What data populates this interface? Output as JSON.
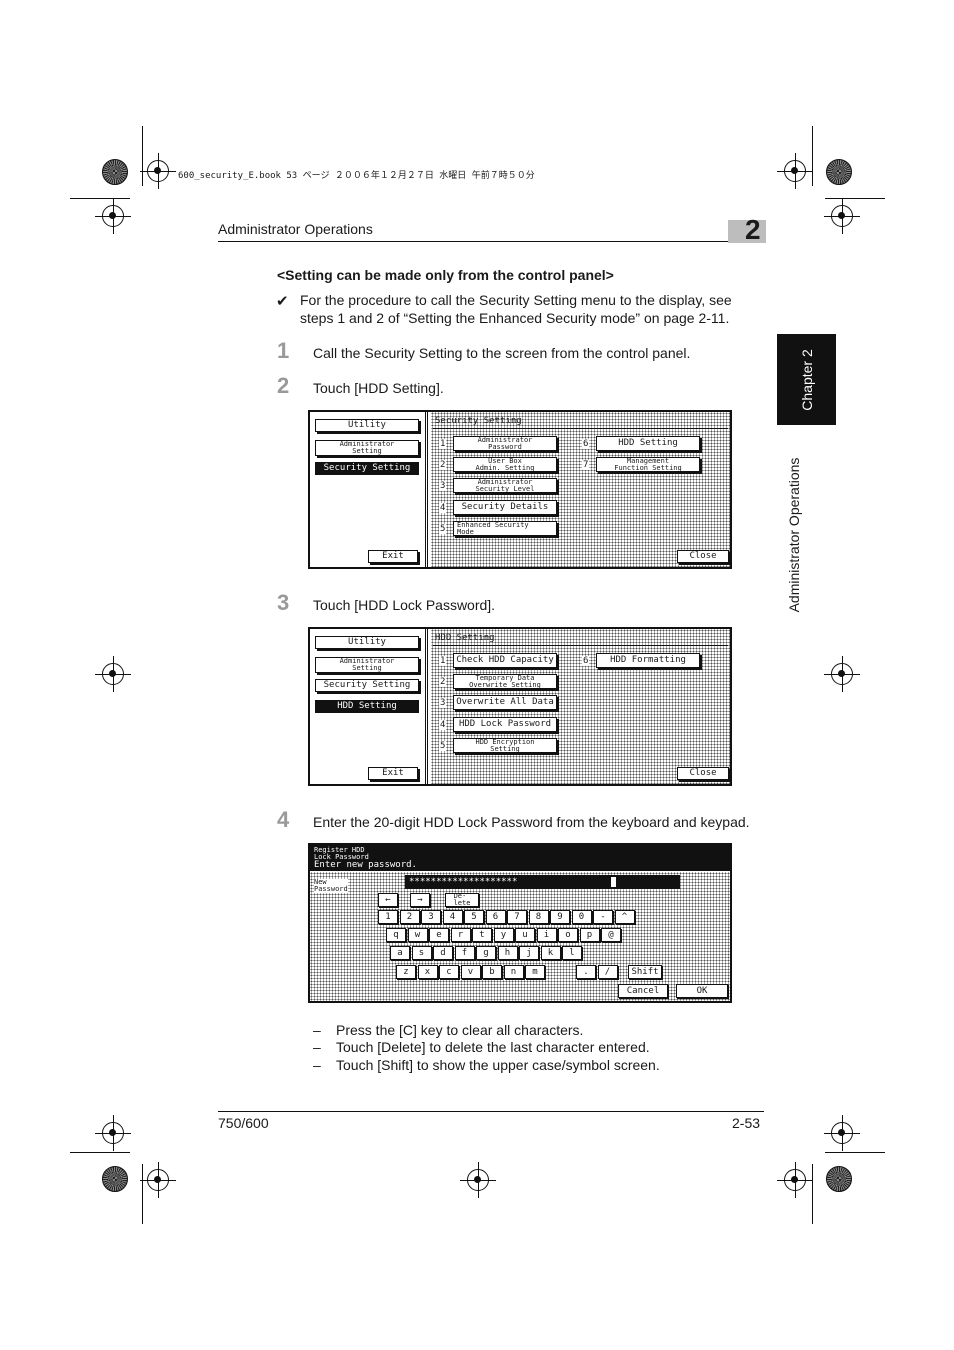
{
  "file_info": "600_security_E.book  53 ページ  ２００６年１２月２７日  水曜日  午前７時５０分",
  "header": {
    "title": "Administrator Operations",
    "chapter_number": "2"
  },
  "side_tab": {
    "chapter": "Chapter 2",
    "section": "Administrator Operations"
  },
  "section_heading": "<Setting can be made only from the control panel>",
  "note": {
    "icon": "✔",
    "text": "For the procedure to call the Security Setting menu to the display, see steps 1 and 2 of “Setting the Enhanced Security mode” on page 2-11."
  },
  "steps": [
    {
      "num": "1",
      "text": "Call the Security Setting to the screen from the control panel."
    },
    {
      "num": "2",
      "text": "Touch [HDD Setting]."
    },
    {
      "num": "3",
      "text": "Touch [HDD Lock Password]."
    },
    {
      "num": "4",
      "text": "Enter the 20-digit HDD Lock Password from the keyboard and keypad."
    }
  ],
  "screen1": {
    "left": [
      "Utility",
      "Administrator\nSetting",
      "Security Setting"
    ],
    "exit": "Exit",
    "title": "Security Setting",
    "items": [
      {
        "n": "1",
        "label": "Administrator\nPassword"
      },
      {
        "n": "2",
        "label": "User Box\nAdmin. Setting"
      },
      {
        "n": "3",
        "label": "Administrator\nSecurity Level"
      },
      {
        "n": "4",
        "label": "Security Details"
      },
      {
        "n": "5",
        "label": "Enhanced Security\nMode"
      },
      {
        "n": "6",
        "label": "HDD Setting"
      },
      {
        "n": "7",
        "label": "Management\nFunction Setting"
      }
    ],
    "close": "Close"
  },
  "screen2": {
    "left": [
      "Utility",
      "Administrator\nSetting",
      "Security Setting",
      "HDD Setting"
    ],
    "exit": "Exit",
    "title": "HDD Setting",
    "items": [
      {
        "n": "1",
        "label": "Check HDD Capacity"
      },
      {
        "n": "2",
        "label": "Temporary Data\nOverwrite Setting"
      },
      {
        "n": "3",
        "label": "Overwrite All Data"
      },
      {
        "n": "4",
        "label": "HDD Lock Password"
      },
      {
        "n": "5",
        "label": "HDD Encryption\nSetting"
      },
      {
        "n": "6",
        "label": "HDD Formatting"
      }
    ],
    "close": "Close"
  },
  "screen3": {
    "title": "Register HDD\nLock Password",
    "subtitle": "Enter new password.",
    "field_label": "New\nPassword",
    "field_value": "********************",
    "left_arrow": "←",
    "right_arrow": "→",
    "delete": "De-\nlete",
    "row1": [
      "1",
      "2",
      "3",
      "4",
      "5",
      "6",
      "7",
      "8",
      "9",
      "0",
      "-",
      "^"
    ],
    "row2": [
      "q",
      "w",
      "e",
      "r",
      "t",
      "y",
      "u",
      "i",
      "o",
      "p",
      "@"
    ],
    "row3": [
      "a",
      "s",
      "d",
      "f",
      "g",
      "h",
      "j",
      "k",
      "l"
    ],
    "row4": [
      "z",
      "x",
      "c",
      "v",
      "b",
      "n",
      "m",
      ".",
      "/"
    ],
    "shift": "Shift",
    "cancel": "Cancel",
    "ok": "OK"
  },
  "bullets": [
    "Press the [C] key to clear all characters.",
    "Touch [Delete] to delete the last character entered.",
    "Touch [Shift] to show the upper case/symbol screen."
  ],
  "bullet_dash": "–",
  "footer": {
    "model": "750/600",
    "page": "2-53"
  }
}
